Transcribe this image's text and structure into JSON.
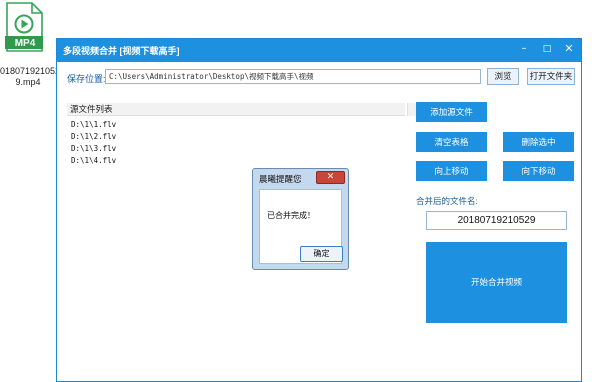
{
  "desktop": {
    "file_badge": "MP4",
    "file_name_line1": "018071921052",
    "file_name_line2": "9.mp4"
  },
  "window": {
    "title": "多段视频合并 [视频下载高手]",
    "minimize": "–",
    "maximize": "□",
    "close": "✕"
  },
  "save": {
    "label": "保存位置:",
    "path": "C:\\Users\\Administrator\\Desktop\\视频下载高手\\视频",
    "browse": "浏览",
    "open_folder": "打开文件夹"
  },
  "list": {
    "header": "源文件列表",
    "items": [
      "D:\\1\\1.flv",
      "D:\\1\\2.flv",
      "D:\\1\\3.flv",
      "D:\\1\\4.flv"
    ]
  },
  "actions": {
    "add": "添加源文件",
    "clear": "清空表格",
    "delete": "删除选中",
    "up": "向上移动",
    "down": "向下移动"
  },
  "merge": {
    "label": "合并后的文件名:",
    "filename": "20180719210529",
    "start": "开始合并视频"
  },
  "dialog": {
    "title": "晨曦提醒您",
    "close": "✕",
    "message": "已合并完成！",
    "ok": "确定"
  }
}
